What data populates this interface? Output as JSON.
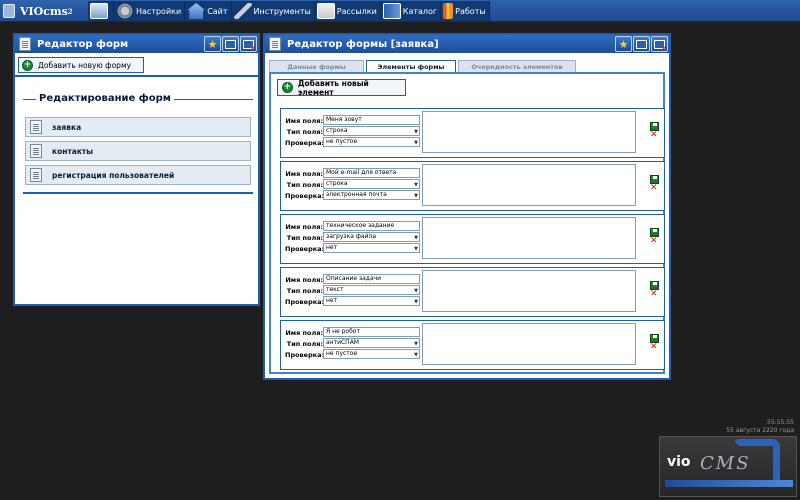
{
  "topbar": {
    "logo": "VIOcms",
    "logo_sup": "2",
    "menu": [
      {
        "label": "",
        "icon": "window-icon"
      },
      {
        "label": "Настройки",
        "icon": "gear-icon"
      },
      {
        "label": "Сайт",
        "icon": "house-icon"
      },
      {
        "label": "Инструменты",
        "icon": "tools-icon"
      },
      {
        "label": "Рассылки",
        "icon": "mail-icon"
      },
      {
        "label": "Каталог",
        "icon": "book-icon"
      },
      {
        "label": "Работы",
        "icon": "work-icon"
      }
    ]
  },
  "left_window": {
    "title": "Редактор форм",
    "add_button": "Добавить новую форму",
    "section_title": "Редактирование форм",
    "forms": [
      {
        "label": "заявка"
      },
      {
        "label": "контакты"
      },
      {
        "label": "регистрация пользователей"
      }
    ]
  },
  "right_window": {
    "title": "Редактор формы [заявка]",
    "tabs": [
      {
        "label": "Данные формы"
      },
      {
        "label": "Элементы формы"
      },
      {
        "label": "Очередность элементов"
      }
    ],
    "active_tab": "Элементы формы",
    "add_element_button": "Добавить новый элемент",
    "field_labels": {
      "name": "Имя поля:",
      "type": "Тип поля:",
      "check": "Проверка:"
    },
    "elements": [
      {
        "name": "Меня зовут",
        "type": "строка",
        "check": "не пустое"
      },
      {
        "name": "Мой e-mail для ответа",
        "type": "строка",
        "check": "электронная почта"
      },
      {
        "name": "техническое задание",
        "type": "загрузка файла",
        "check": "нет"
      },
      {
        "name": "Описание задачи",
        "type": "текст",
        "check": "нет"
      },
      {
        "name": "Я не робот",
        "type": "антиСПАМ",
        "check": "не пустое"
      }
    ]
  },
  "clock": {
    "time": "55:55:55",
    "date": "55 августа 2220 года"
  },
  "brand": {
    "vio": "vio",
    "cms": "CMS"
  },
  "colors": {
    "accent": "#1f5db1",
    "desktop": "#1e1e1e",
    "delete": "#d91818",
    "save": "#1a6e27"
  }
}
